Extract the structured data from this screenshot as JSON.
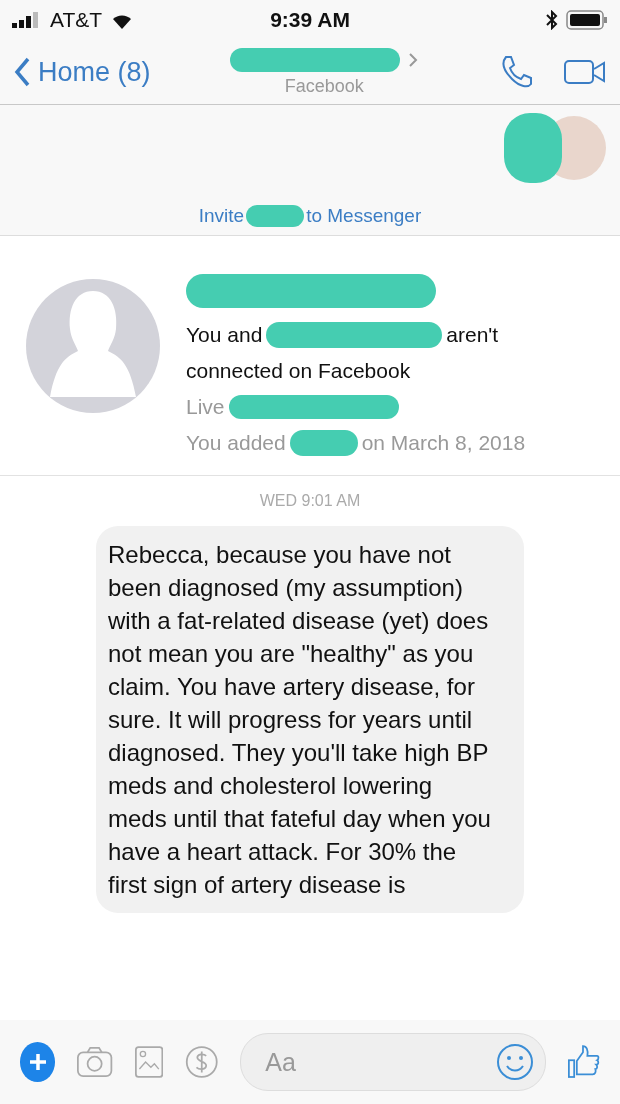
{
  "status_bar": {
    "carrier": "AT&T",
    "time": "9:39 AM"
  },
  "nav": {
    "back_label": "Home (8)",
    "subtitle": "Facebook"
  },
  "invite": {
    "before": "Invite",
    "after": "to Messenger"
  },
  "profile": {
    "connection_before": "You and",
    "connection_after": "aren't",
    "connection_line2": "connected on Facebook",
    "lives_prefix": "Live",
    "added_before": "You added",
    "added_after": "on March 8, 2018"
  },
  "timestamp": "WED 9:01 AM",
  "message": {
    "text": "Rebecca, because you have not been diagnosed (my assumption) with a fat-related disease (yet) does not mean you are \"healthy\" as you claim. You have artery disease, for sure. It will progress for years until diagnosed. They you'll take high BP meds and cholesterol lowering meds until that fateful day when you have a heart attack. For 30% the first sign of artery disease is"
  },
  "composer": {
    "placeholder": "Aa"
  }
}
